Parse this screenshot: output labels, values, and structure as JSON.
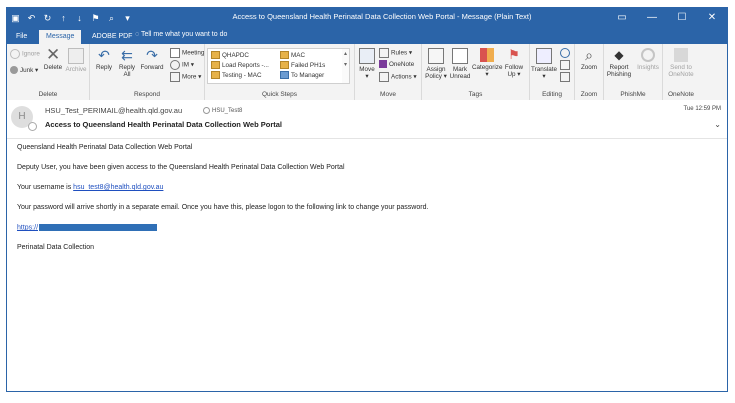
{
  "window": {
    "title": "Access to Queensland Health Perinatal Data Collection Web Portal  -  Message (Plain Text)"
  },
  "tabs": [
    {
      "label": "File"
    },
    {
      "label": "Message"
    },
    {
      "label": "ADOBE PDF"
    }
  ],
  "tell_me": "Tell me what you want to do",
  "ribbon": {
    "delete": {
      "ignore": "Ignore",
      "junk": "Junk",
      "delete": "Delete",
      "archive": "Archive",
      "group": "Delete"
    },
    "respond": {
      "reply": "Reply",
      "reply_all_1": "Reply",
      "reply_all_2": "All",
      "forward": "Forward",
      "meeting": "Meeting",
      "im": "IM",
      "more": "More",
      "group": "Respond"
    },
    "quick_steps": {
      "items": [
        "QHAPDC",
        "Load Reports -...",
        "Testing - MAC",
        "MAC",
        "Failed PH1s",
        "To Manager"
      ],
      "group": "Quick Steps"
    },
    "move": {
      "move": "Move",
      "rules": "Rules",
      "onenote": "OneNote",
      "actions": "Actions",
      "group": "Move"
    },
    "tags": {
      "assign_1": "Assign",
      "assign_2": "Policy",
      "mark_1": "Mark",
      "mark_2": "Unread",
      "categorize": "Categorize",
      "follow_1": "Follow",
      "follow_2": "Up",
      "group": "Tags"
    },
    "editing": {
      "translate": "Translate",
      "group": "Editing"
    },
    "zoom": {
      "zoom": "Zoom",
      "group": "Zoom"
    },
    "phishme": {
      "report_1": "Report",
      "report_2": "Phishing",
      "insights": "Insights",
      "group": "PhishMe"
    },
    "onenote": {
      "send_1": "Send to",
      "send_2": "OneNote",
      "group": "OneNote"
    }
  },
  "message": {
    "avatar_letter": "H",
    "sender": "HSU_Test_PERIMAIL@health.qld.gov.au",
    "to": "HSU_Test8",
    "subject": "Access to Queensland Health Perinatal Data Collection Web Portal",
    "time": "Tue 12:59 PM",
    "body": {
      "line1": "Queensland Health Perinatal Data Collection Web Portal",
      "line2": "Deputy User, you have been given access to the Queensland Health Perinatal Data Collection Web Portal",
      "line3_prefix": "Your username is ",
      "username": "hsu_test8@health.qld.gov.au",
      "line4": "Your password will arrive shortly in a separate email. Once you have this, please logon to the following link to change your password.",
      "link": "https://",
      "signature": "Perinatal Data Collection"
    }
  }
}
